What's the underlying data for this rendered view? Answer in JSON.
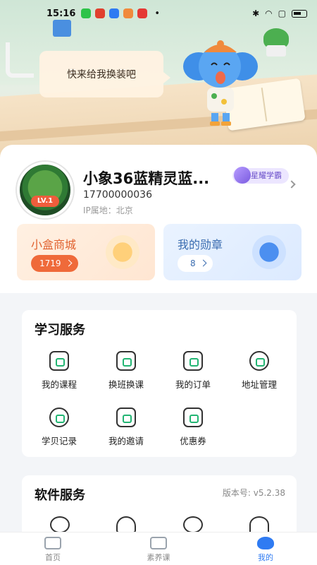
{
  "status_bar": {
    "time": "15:16"
  },
  "hero": {
    "bubble_text": "快来给我换装吧"
  },
  "profile": {
    "avatar_level": "LV.1",
    "name": "小象36蓝精灵蓝...",
    "badge": "星耀学霸",
    "phone": "17700000036",
    "ip_location": "IP属地：北京"
  },
  "tiles": {
    "shop": {
      "title": "小盒商城",
      "count": "1719"
    },
    "medal": {
      "title": "我的勋章",
      "count": "8"
    }
  },
  "learning": {
    "title": "学习服务",
    "items": [
      {
        "label": "我的课程",
        "icon": "course-icon"
      },
      {
        "label": "换班换课",
        "icon": "swap-icon"
      },
      {
        "label": "我的订单",
        "icon": "order-icon"
      },
      {
        "label": "地址管理",
        "icon": "location-icon"
      },
      {
        "label": "学贝记录",
        "icon": "coin-icon"
      },
      {
        "label": "我的邀请",
        "icon": "invite-icon"
      },
      {
        "label": "优惠券",
        "icon": "coupon-icon"
      }
    ]
  },
  "software": {
    "title": "软件服务",
    "version": "版本号: v5.2.38",
    "icons": [
      "settings-icon",
      "headset-icon",
      "chat-icon",
      "wifi-icon"
    ]
  },
  "tabbar": {
    "tabs": [
      {
        "label": "首页"
      },
      {
        "label": "素养课"
      },
      {
        "label": "我的"
      }
    ],
    "active_color": "#2f7bf2"
  }
}
